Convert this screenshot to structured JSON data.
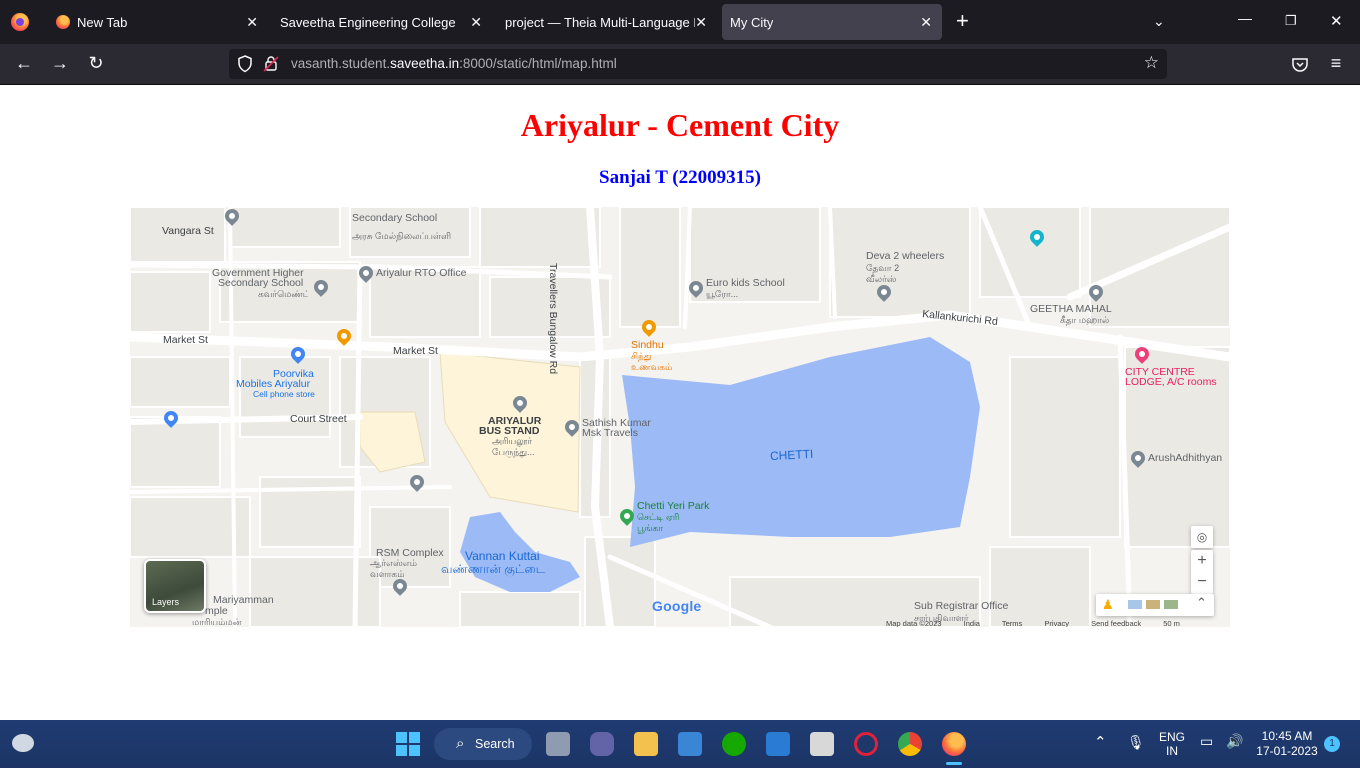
{
  "browser": {
    "tabs": [
      {
        "title": "New Tab",
        "active": false
      },
      {
        "title": "Saveetha Engineering College",
        "active": false
      },
      {
        "title": "project — Theia Multi-Language Ex",
        "active": false
      },
      {
        "title": "My City",
        "active": true
      }
    ],
    "new_tab_symbol": "+",
    "url_prefix": "vasanth.student.",
    "url_domain": "saveetha.in",
    "url_suffix": ":8000/static/html/map.html"
  },
  "page": {
    "title": "Ariyalur - Cement City",
    "subtitle": "Sanjai T (22009315)"
  },
  "map": {
    "labels": {
      "secondary_school": "Secondary School",
      "secondary_school_ta": "அரசு மேல்நிலைப்பள்ளி",
      "vangara_st": "Vangara St",
      "govt_higher_1": "Government Higher",
      "govt_higher_2": "Secondary School",
      "govt_higher_ta": "கவர்மெண்ட் ஹையர்...",
      "rto": "Ariyalur RTO Office",
      "travellers_rd": "Travellers Bungalow Rd",
      "euro_kids": "Euro kids School",
      "euro_kids_ta": "யூரோ...",
      "deva": "Deva 2 wheelers",
      "deva_ta": "தேவா 2 வீலர்ஸ்",
      "geetha": "GEETHA MAHAL",
      "geetha_ta": "கீதா மஹால்",
      "kallankurichi": "Kallankurichi Rd",
      "market_st_left": "Market St",
      "market_st": "Market St",
      "sindhu": "Sindhu",
      "sindhu_ta": "சிந்து உணவகம்",
      "city_centre_1": "CITY CENTRE",
      "city_centre_2": "LODGE, A/C rooms",
      "poorvika_1": "Poorvika",
      "poorvika_2": "Mobiles Ariyalur",
      "poorvika_3": "Cell phone store",
      "court_st": "Court Street",
      "bus_stand_1": "ARIYALUR",
      "bus_stand_2": "BUS STAND",
      "bus_stand_ta": "அரியலூர் பேருந்து...",
      "sathish_1": "Sathish Kumar",
      "sathish_2": "Msk Travels",
      "chetti": "CHETTI",
      "arush": "ArushAdhithyan",
      "chetti_park": "Chetti Yeri Park",
      "chetti_park_ta": "செட்டி ஏரி பூங்கா",
      "rsm_1": "RSM Complex",
      "rsm_ta": "ஆர்எஸ்எம் வளாகம்",
      "vannan_1": "Vannan Kuttai",
      "vannan_ta": "வண்ணான் குட்டை",
      "mariyamman_1": "Mariyamman",
      "mariyamman_2": "mple",
      "mariyamman_ta": "மாரியம்மன்",
      "sub_registrar": "Sub Registrar Office",
      "sub_registrar_ta": "சார்பதிவாளர்"
    },
    "layers_label": "Layers",
    "google_logo": "Google",
    "attribution": [
      "Map data ©2023",
      "India",
      "Terms",
      "Privacy",
      "Send feedback",
      "50 m"
    ],
    "zoom_in": "+",
    "zoom_out": "−",
    "colors": {
      "water": "#9cbbf6",
      "land": "#f5f3ef",
      "block": "#ebe9e4",
      "road": "#ffffff",
      "highlight": "#fdf4d9"
    }
  },
  "taskbar": {
    "search_label": "Search",
    "lang_1": "ENG",
    "lang_2": "IN",
    "time": "10:45 AM",
    "date": "17-01-2023",
    "notification_count": "1"
  }
}
